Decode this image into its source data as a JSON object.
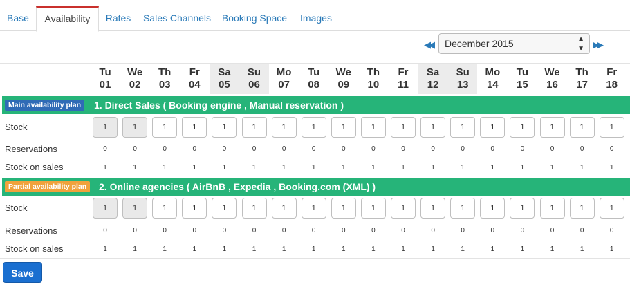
{
  "tabs": [
    {
      "label": "Base"
    },
    {
      "label": "Availability",
      "active": true
    },
    {
      "label": "Rates"
    },
    {
      "label": "Sales Channels"
    },
    {
      "label": "Booking Space"
    },
    {
      "label": "Images"
    }
  ],
  "month_selector": {
    "prev_icon": "double-chevron-left-icon",
    "next_icon": "double-chevron-right-icon",
    "selected": "December 2015"
  },
  "days": [
    {
      "dow": "Tu",
      "num": "01",
      "weekend": false
    },
    {
      "dow": "We",
      "num": "02",
      "weekend": false
    },
    {
      "dow": "Th",
      "num": "03",
      "weekend": false
    },
    {
      "dow": "Fr",
      "num": "04",
      "weekend": false
    },
    {
      "dow": "Sa",
      "num": "05",
      "weekend": true
    },
    {
      "dow": "Su",
      "num": "06",
      "weekend": true
    },
    {
      "dow": "Mo",
      "num": "07",
      "weekend": false
    },
    {
      "dow": "Tu",
      "num": "08",
      "weekend": false
    },
    {
      "dow": "We",
      "num": "09",
      "weekend": false
    },
    {
      "dow": "Th",
      "num": "10",
      "weekend": false
    },
    {
      "dow": "Fr",
      "num": "11",
      "weekend": false
    },
    {
      "dow": "Sa",
      "num": "12",
      "weekend": true
    },
    {
      "dow": "Su",
      "num": "13",
      "weekend": true
    },
    {
      "dow": "Mo",
      "num": "14",
      "weekend": false
    },
    {
      "dow": "Tu",
      "num": "15",
      "weekend": false
    },
    {
      "dow": "We",
      "num": "16",
      "weekend": false
    },
    {
      "dow": "Th",
      "num": "17",
      "weekend": false
    },
    {
      "dow": "Fr",
      "num": "18",
      "weekend": false
    }
  ],
  "row_labels": {
    "stock": "Stock",
    "reservations": "Reservations",
    "stock_on_sales": "Stock on sales"
  },
  "plans": [
    {
      "badge": "Main availability plan",
      "badge_color": "#2f6bb6",
      "title": "1. Direct Sales ( Booking engine , Manual reservation )",
      "stock": [
        "1",
        "1",
        "1",
        "1",
        "1",
        "1",
        "1",
        "1",
        "1",
        "1",
        "1",
        "1",
        "1",
        "1",
        "1",
        "1",
        "1",
        "1"
      ],
      "stock_disabled": [
        true,
        true
      ],
      "reservations": [
        "0",
        "0",
        "0",
        "0",
        "0",
        "0",
        "0",
        "0",
        "0",
        "0",
        "0",
        "0",
        "0",
        "0",
        "0",
        "0",
        "0",
        "0"
      ],
      "stock_on_sales": [
        "1",
        "1",
        "1",
        "1",
        "1",
        "1",
        "1",
        "1",
        "1",
        "1",
        "1",
        "1",
        "1",
        "1",
        "1",
        "1",
        "1",
        "1"
      ]
    },
    {
      "badge": "Partial availability plan",
      "badge_color": "#f0a23c",
      "title": "2. Online agencies ( AirBnB , Expedia , Booking.com (XML) )",
      "stock": [
        "1",
        "1",
        "1",
        "1",
        "1",
        "1",
        "1",
        "1",
        "1",
        "1",
        "1",
        "1",
        "1",
        "1",
        "1",
        "1",
        "1",
        "1"
      ],
      "stock_disabled": [
        true,
        true
      ],
      "reservations": [
        "0",
        "0",
        "0",
        "0",
        "0",
        "0",
        "0",
        "0",
        "0",
        "0",
        "0",
        "0",
        "0",
        "0",
        "0",
        "0",
        "0",
        "0"
      ],
      "stock_on_sales": [
        "1",
        "1",
        "1",
        "1",
        "1",
        "1",
        "1",
        "1",
        "1",
        "1",
        "1",
        "1",
        "1",
        "1",
        "1",
        "1",
        "1",
        "1"
      ]
    }
  ],
  "save_label": "Save",
  "colors": {
    "accent": "#2a7ab8",
    "plan_bar": "#26b479",
    "save_button": "#1a6fd0",
    "active_tab_top": "#c9302c"
  }
}
